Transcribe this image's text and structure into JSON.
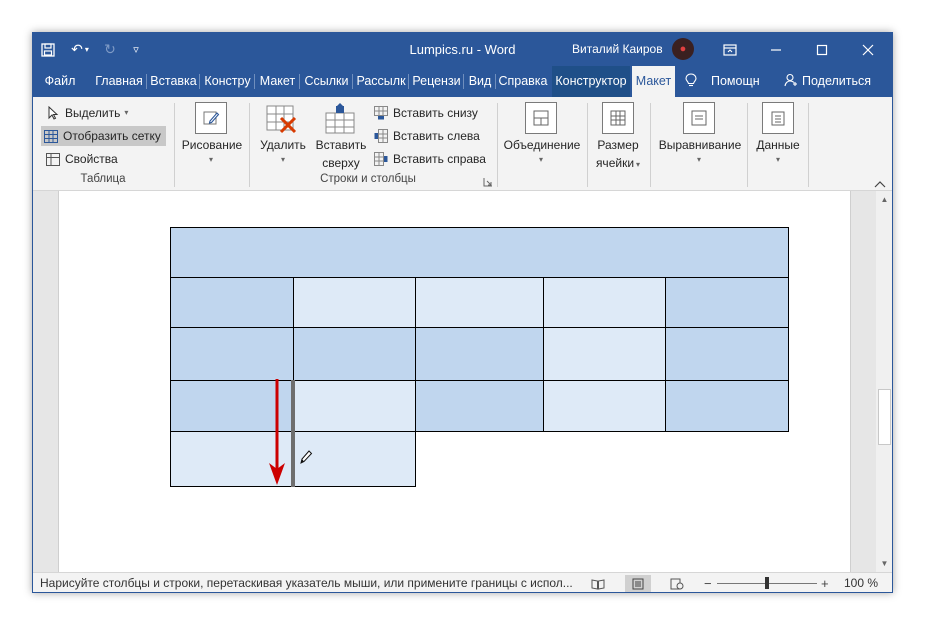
{
  "window": {
    "title_app": "Lumpics.ru",
    "title_sep": "-",
    "title_prog": "Word",
    "user_name": "Виталий Каиров",
    "colors": {
      "accent": "#2b579a",
      "table_dark": "#c0d6ee",
      "table_light": "#deeaf7",
      "arrow": "#cc0000"
    }
  },
  "qat": {
    "save_icon": "save-icon",
    "undo_icon": "undo-icon",
    "redo_icon": "redo-icon",
    "customize_icon": "customize-icon"
  },
  "tabs": [
    "Файл",
    "Главная",
    "Вставка",
    "Констру",
    "Макет",
    "Ссылки",
    "Рассылк",
    "Рецензи",
    "Вид",
    "Справка",
    "Конструктор",
    "Макет"
  ],
  "tell_me": "Помощн",
  "share": "Поделиться",
  "ribbon": {
    "table_group": {
      "select": "Выделить",
      "show_grid": "Отобразить сетку",
      "properties": "Свойства",
      "label": "Таблица"
    },
    "draw": {
      "label": "Рисование"
    },
    "rows_cols": {
      "delete": "Удалить",
      "insert_above_1": "Вставить",
      "insert_above_2": "сверху",
      "insert_below": "Вставить снизу",
      "insert_left": "Вставить слева",
      "insert_right": "Вставить справа",
      "label": "Строки и столбцы"
    },
    "merge": {
      "label": "Объединение"
    },
    "cell_size": {
      "label1": "Размер",
      "label2": "ячейки"
    },
    "alignment": {
      "label": "Выравнивание"
    },
    "data": {
      "label": "Данные"
    }
  },
  "status": {
    "message": "Нарисуйте столбцы и строки, перетаскивая указатель мыши, или примените границы с испол...",
    "zoom_minus": "−",
    "zoom_plus": "+",
    "zoom": "100 %",
    "zoom_level_percent": 100
  }
}
